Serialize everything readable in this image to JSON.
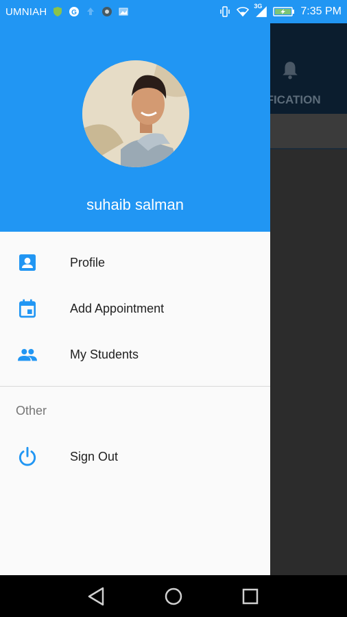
{
  "status_bar": {
    "carrier": "UMNIAH",
    "network_type": "3G",
    "time": "7:35 PM"
  },
  "background_app": {
    "tab_label": "NOTIFICATION",
    "icon": "bell-icon"
  },
  "drawer": {
    "user_name": "suhaib salman",
    "menu_items": [
      {
        "label": "Profile",
        "icon": "account-box-icon"
      },
      {
        "label": "Add Appointment",
        "icon": "calendar-icon"
      },
      {
        "label": "My Students",
        "icon": "people-icon"
      }
    ],
    "section_title": "Other",
    "other_items": [
      {
        "label": "Sign Out",
        "icon": "power-icon"
      }
    ]
  },
  "colors": {
    "primary": "#2196f3",
    "drawer_bg": "#fafafa",
    "text": "#212121",
    "secondary_text": "#757575"
  }
}
